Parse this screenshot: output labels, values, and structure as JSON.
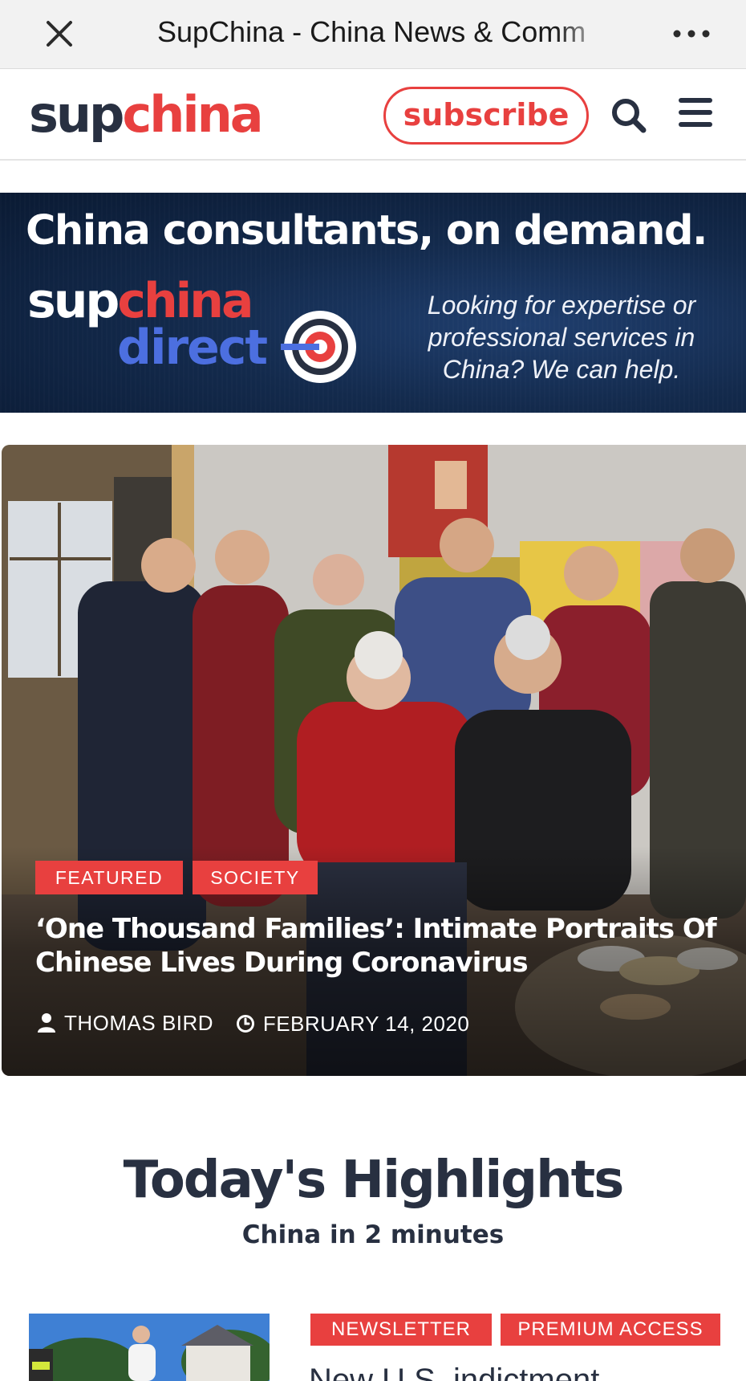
{
  "browser": {
    "title": "SupChina - China News & Comm",
    "close_icon": "close-icon",
    "more_icon": "more-horizontal-icon"
  },
  "header": {
    "logo_part1": "sup",
    "logo_part2": "china",
    "subscribe_label": "subscribe",
    "search_icon": "search-icon",
    "menu_icon": "hamburger-menu-icon"
  },
  "ad": {
    "headline": "China consultants, on demand.",
    "logo_sup": "sup",
    "logo_china": "china",
    "logo_direct": "direct",
    "tagline": "Looking for expertise or professional services in China? We can help."
  },
  "featured": {
    "badges": [
      "FEATURED",
      "SOCIETY"
    ],
    "title": "‘One Thousand Families’: Intimate Portraits Of Chinese Lives During Coronavirus",
    "author": "THOMAS BIRD",
    "date": "FEBRUARY 14, 2020"
  },
  "highlights": {
    "title": "Today's Highlights",
    "subtitle": "China in 2 minutes"
  },
  "article": {
    "tags": [
      "NEWSLETTER",
      "PREMIUM ACCESS"
    ],
    "title_peek": "New U.S. indictment"
  },
  "colors": {
    "brand_red": "#e8403f",
    "brand_navy": "#283041",
    "direct_blue": "#4c6fe0"
  }
}
